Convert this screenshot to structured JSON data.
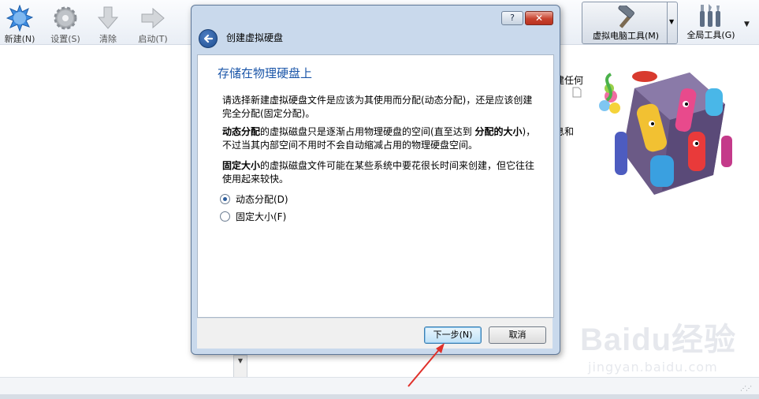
{
  "toolbar": {
    "new_label": "新建(N)",
    "settings_label": "设置(S)",
    "discard_label": "清除",
    "start_label": "启动(T)",
    "machine_tools_label": "虚拟电脑工具(M)",
    "global_tools_label": "全局工具(G)"
  },
  "background": {
    "peek_line1": "建任何",
    "peek_line2": "息和"
  },
  "dialog": {
    "title": "创建虚拟硬盘",
    "help_glyph": "?",
    "close_glyph": "✕",
    "page_title": "存储在物理硬盘上",
    "para1": "请选择新建虚拟硬盘文件是应该为其使用而分配(动态分配)，还是应该创建完全分配(固定分配)。",
    "para2_bold1": "动态分配",
    "para2_text1": "的虚拟磁盘只是逐渐占用物理硬盘的空间(直至达到 ",
    "para2_bold2": "分配的大小",
    "para2_text2": ")，不过当其内部空间不用时不会自动缩减占用的物理硬盘空间。",
    "para3_bold": "固定大小",
    "para3_text": "的虚拟磁盘文件可能在某些系统中要花很长时间来创建，但它往往使用起来较快。",
    "options": [
      {
        "label": "动态分配(D)",
        "selected": true
      },
      {
        "label": "固定大小(F)",
        "selected": false
      }
    ],
    "next_label": "下一步(N)",
    "cancel_label": "取消"
  },
  "watermark": {
    "main": "Baidu经验",
    "sub": "jingyan.baidu.com"
  },
  "colors": {
    "dialog_frame": "#c9d9ec",
    "page_title": "#1a55a8",
    "annotation_arrow": "#e0302a"
  }
}
